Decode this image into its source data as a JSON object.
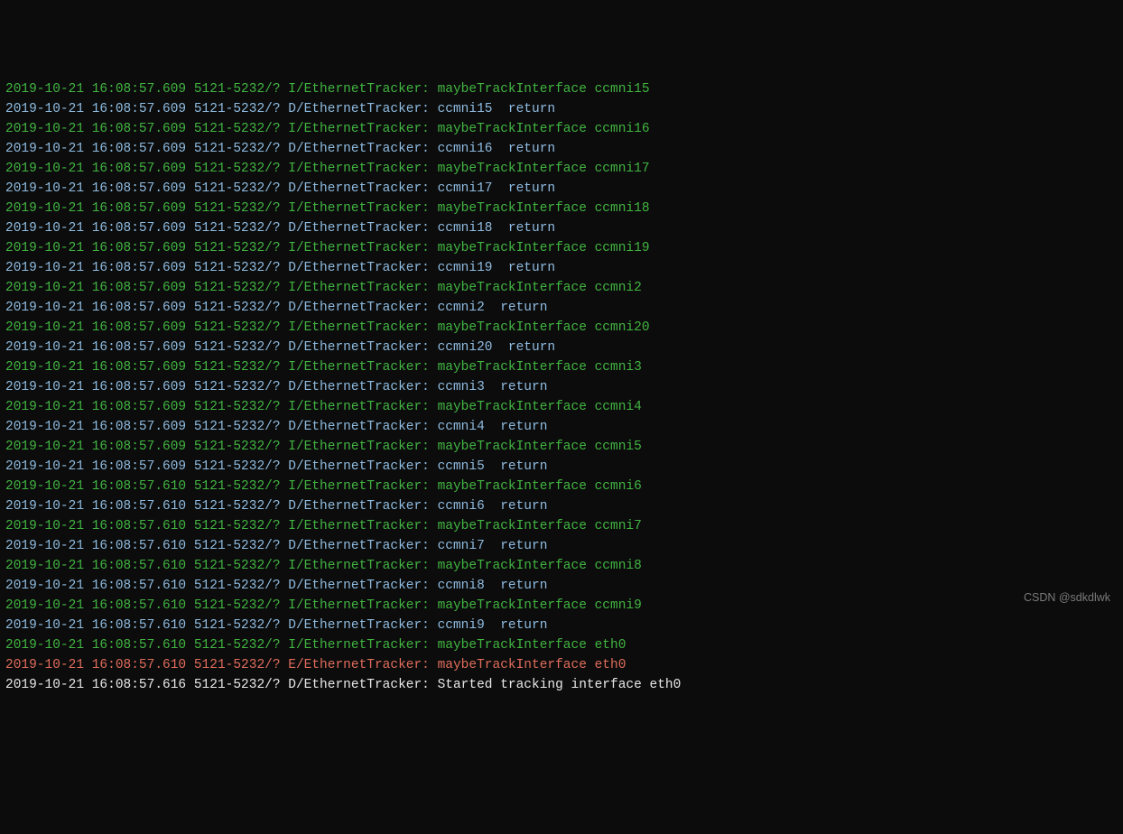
{
  "watermark": "CSDN @sdkdlwk",
  "log_colors": {
    "I": "lvl-I",
    "D": "lvl-D",
    "E": "lvl-E",
    "Dw": "lvl-Dw"
  },
  "lines": [
    {
      "ts": "2019-10-21 16:08:57.609",
      "pidtid": "5121-5232/?",
      "level": "I",
      "tag": "EthernetTracker",
      "msg": "maybeTrackInterface ccmni15"
    },
    {
      "ts": "2019-10-21 16:08:57.609",
      "pidtid": "5121-5232/?",
      "level": "D",
      "tag": "EthernetTracker",
      "msg": "ccmni15  return"
    },
    {
      "ts": "2019-10-21 16:08:57.609",
      "pidtid": "5121-5232/?",
      "level": "I",
      "tag": "EthernetTracker",
      "msg": "maybeTrackInterface ccmni16"
    },
    {
      "ts": "2019-10-21 16:08:57.609",
      "pidtid": "5121-5232/?",
      "level": "D",
      "tag": "EthernetTracker",
      "msg": "ccmni16  return"
    },
    {
      "ts": "2019-10-21 16:08:57.609",
      "pidtid": "5121-5232/?",
      "level": "I",
      "tag": "EthernetTracker",
      "msg": "maybeTrackInterface ccmni17"
    },
    {
      "ts": "2019-10-21 16:08:57.609",
      "pidtid": "5121-5232/?",
      "level": "D",
      "tag": "EthernetTracker",
      "msg": "ccmni17  return"
    },
    {
      "ts": "2019-10-21 16:08:57.609",
      "pidtid": "5121-5232/?",
      "level": "I",
      "tag": "EthernetTracker",
      "msg": "maybeTrackInterface ccmni18"
    },
    {
      "ts": "2019-10-21 16:08:57.609",
      "pidtid": "5121-5232/?",
      "level": "D",
      "tag": "EthernetTracker",
      "msg": "ccmni18  return"
    },
    {
      "ts": "2019-10-21 16:08:57.609",
      "pidtid": "5121-5232/?",
      "level": "I",
      "tag": "EthernetTracker",
      "msg": "maybeTrackInterface ccmni19"
    },
    {
      "ts": "2019-10-21 16:08:57.609",
      "pidtid": "5121-5232/?",
      "level": "D",
      "tag": "EthernetTracker",
      "msg": "ccmni19  return"
    },
    {
      "ts": "2019-10-21 16:08:57.609",
      "pidtid": "5121-5232/?",
      "level": "I",
      "tag": "EthernetTracker",
      "msg": "maybeTrackInterface ccmni2"
    },
    {
      "ts": "2019-10-21 16:08:57.609",
      "pidtid": "5121-5232/?",
      "level": "D",
      "tag": "EthernetTracker",
      "msg": "ccmni2  return"
    },
    {
      "ts": "2019-10-21 16:08:57.609",
      "pidtid": "5121-5232/?",
      "level": "I",
      "tag": "EthernetTracker",
      "msg": "maybeTrackInterface ccmni20"
    },
    {
      "ts": "2019-10-21 16:08:57.609",
      "pidtid": "5121-5232/?",
      "level": "D",
      "tag": "EthernetTracker",
      "msg": "ccmni20  return"
    },
    {
      "ts": "2019-10-21 16:08:57.609",
      "pidtid": "5121-5232/?",
      "level": "I",
      "tag": "EthernetTracker",
      "msg": "maybeTrackInterface ccmni3"
    },
    {
      "ts": "2019-10-21 16:08:57.609",
      "pidtid": "5121-5232/?",
      "level": "D",
      "tag": "EthernetTracker",
      "msg": "ccmni3  return"
    },
    {
      "ts": "2019-10-21 16:08:57.609",
      "pidtid": "5121-5232/?",
      "level": "I",
      "tag": "EthernetTracker",
      "msg": "maybeTrackInterface ccmni4"
    },
    {
      "ts": "2019-10-21 16:08:57.609",
      "pidtid": "5121-5232/?",
      "level": "D",
      "tag": "EthernetTracker",
      "msg": "ccmni4  return"
    },
    {
      "ts": "2019-10-21 16:08:57.609",
      "pidtid": "5121-5232/?",
      "level": "I",
      "tag": "EthernetTracker",
      "msg": "maybeTrackInterface ccmni5"
    },
    {
      "ts": "2019-10-21 16:08:57.609",
      "pidtid": "5121-5232/?",
      "level": "D",
      "tag": "EthernetTracker",
      "msg": "ccmni5  return"
    },
    {
      "ts": "2019-10-21 16:08:57.610",
      "pidtid": "5121-5232/?",
      "level": "I",
      "tag": "EthernetTracker",
      "msg": "maybeTrackInterface ccmni6"
    },
    {
      "ts": "2019-10-21 16:08:57.610",
      "pidtid": "5121-5232/?",
      "level": "D",
      "tag": "EthernetTracker",
      "msg": "ccmni6  return"
    },
    {
      "ts": "2019-10-21 16:08:57.610",
      "pidtid": "5121-5232/?",
      "level": "I",
      "tag": "EthernetTracker",
      "msg": "maybeTrackInterface ccmni7"
    },
    {
      "ts": "2019-10-21 16:08:57.610",
      "pidtid": "5121-5232/?",
      "level": "D",
      "tag": "EthernetTracker",
      "msg": "ccmni7  return"
    },
    {
      "ts": "2019-10-21 16:08:57.610",
      "pidtid": "5121-5232/?",
      "level": "I",
      "tag": "EthernetTracker",
      "msg": "maybeTrackInterface ccmni8"
    },
    {
      "ts": "2019-10-21 16:08:57.610",
      "pidtid": "5121-5232/?",
      "level": "D",
      "tag": "EthernetTracker",
      "msg": "ccmni8  return"
    },
    {
      "ts": "2019-10-21 16:08:57.610",
      "pidtid": "5121-5232/?",
      "level": "I",
      "tag": "EthernetTracker",
      "msg": "maybeTrackInterface ccmni9"
    },
    {
      "ts": "2019-10-21 16:08:57.610",
      "pidtid": "5121-5232/?",
      "level": "D",
      "tag": "EthernetTracker",
      "msg": "ccmni9  return"
    },
    {
      "ts": "2019-10-21 16:08:57.610",
      "pidtid": "5121-5232/?",
      "level": "I",
      "tag": "EthernetTracker",
      "msg": "maybeTrackInterface eth0"
    },
    {
      "ts": "2019-10-21 16:08:57.610",
      "pidtid": "5121-5232/?",
      "level": "E",
      "tag": "EthernetTracker",
      "msg": "maybeTrackInterface eth0"
    },
    {
      "ts": "2019-10-21 16:08:57.616",
      "pidtid": "5121-5232/?",
      "level": "Dw",
      "tag": "EthernetTracker",
      "msg": "Started tracking interface eth0"
    }
  ]
}
